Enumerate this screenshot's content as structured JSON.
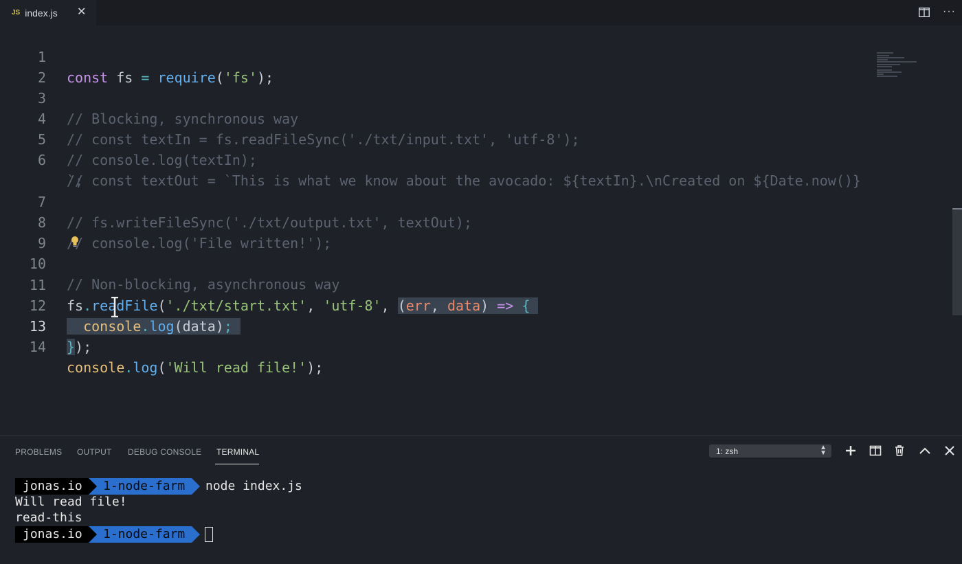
{
  "tab": {
    "badge": "JS",
    "filename": "index.js",
    "close": "✕"
  },
  "toolbar": {
    "more": "···"
  },
  "code": {
    "line_numbers": [
      "1",
      "2",
      "3",
      "4",
      "5",
      "6",
      "",
      "7",
      "8",
      "9",
      "10",
      "11",
      "12",
      "13",
      "14"
    ],
    "l1": {
      "kw": "const",
      "var": " fs ",
      "op": "=",
      "fn": "require",
      "p1": "(",
      "str": "'fs'",
      "p2": ");"
    },
    "l3": "// Blocking, synchronous way",
    "l4": "// const textIn = fs.readFileSync('./txt/input.txt', 'utf-8');",
    "l5": "// console.log(textIn);",
    "l6a": "// const textOut = `This is what we know about the avocado: ${textIn}.\\nCreated on ${Date.now()}",
    "l6b": "`;",
    "l7": "// fs.writeFileSync('./txt/output.txt', textOut);",
    "l8": "// console.log('File written!');",
    "l10": "// Non-blocking, asynchronous way",
    "l11": {
      "obj": "fs",
      "dot": ".",
      "fn": "readFile",
      "p1": "(",
      "s1": "'./txt/start.txt'",
      "c1": ", ",
      "s2": "'utf-8'",
      "c2": ", ",
      "p2": "(",
      "a1": "err",
      "c3": ", ",
      "a2": "data",
      "p3": ")",
      "arrow": " => ",
      "brace": "{"
    },
    "l12": {
      "indent": "  ",
      "obj": "console",
      "dot": ".",
      "fn": "log",
      "p1": "(",
      "arg": "data",
      "p2": ")",
      "semi": ";"
    },
    "l13": {
      "brace": "}",
      "rest": ");"
    },
    "l14": {
      "obj": "console",
      "dot": ".",
      "fn": "log",
      "p1": "(",
      "str": "'Will read file!'",
      "p2": ");"
    }
  },
  "panel": {
    "tabs": [
      "PROBLEMS",
      "OUTPUT",
      "DEBUG CONSOLE",
      "TERMINAL"
    ],
    "active_tab": "TERMINAL",
    "terminal_select": "1: zsh"
  },
  "terminal": {
    "prompt_host": "jonas.io",
    "prompt_dir": "1-node-farm",
    "command": "node index.js",
    "output": [
      "Will read file!",
      "read-this"
    ]
  }
}
